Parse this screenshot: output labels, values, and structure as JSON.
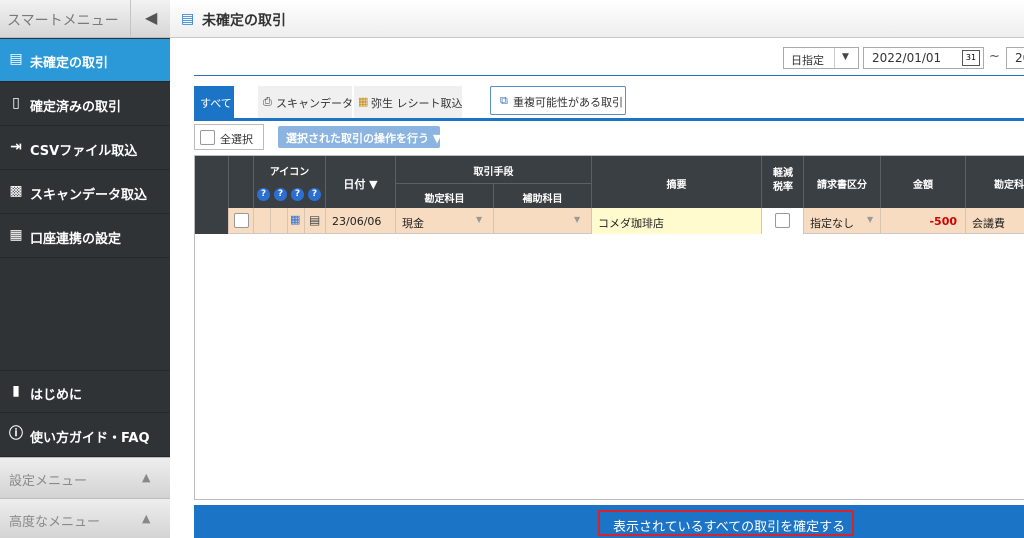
{
  "sidebar": {
    "title": "スマートメニュー",
    "collapse_icon": "chevron-left-icon",
    "items": [
      {
        "label": "未確定の取引",
        "icon": "book-icon",
        "active": true
      },
      {
        "label": "確定済みの取引",
        "icon": "document-icon",
        "active": false
      },
      {
        "label": "CSVファイル取込",
        "icon": "file-import-icon",
        "active": false
      },
      {
        "label": "スキャンデータ取込",
        "icon": "scanner-icon",
        "active": false
      },
      {
        "label": "口座連携の設定",
        "icon": "bank-icon",
        "active": false
      },
      {
        "label": "はじめに",
        "icon": "notebook-icon",
        "active": false
      },
      {
        "label": "使い方ガイド・FAQ",
        "icon": "help-circle-icon",
        "active": false
      }
    ],
    "bottom": [
      {
        "label": "設定メニュー"
      },
      {
        "label": "高度なメニュー"
      }
    ]
  },
  "header": {
    "title": "未確定の取引"
  },
  "filter": {
    "period_type": "日指定",
    "date_from": "2022/01/01",
    "tilde": "~",
    "date_to_partial": "20",
    "calendar_digit": "31"
  },
  "tabs": [
    {
      "label": "すべて",
      "active": true
    },
    {
      "label": "スキャンデータ"
    },
    {
      "label": "弥生 レシート取込"
    }
  ],
  "dup_button": "重複可能性がある取引",
  "toolbar": {
    "select_all": "全選択",
    "operate": "選択された取引の操作を行う ▼"
  },
  "table": {
    "headers": {
      "icon": "アイコン",
      "date": "日付 ▼",
      "method": "取引手段",
      "account": "勘定科目",
      "sub_account": "補助科目",
      "summary": "摘要",
      "reduced_tax": "軽減税率",
      "invoice": "請求書区分",
      "amount": "金額",
      "account2": "勘定科"
    },
    "help_marks": [
      "?",
      "?",
      "?",
      "?"
    ],
    "rows": [
      {
        "date": "23/06/06",
        "method_account": "現金",
        "sub_account": "",
        "summary": "コメダ珈琲店",
        "reduced_tax": false,
        "invoice": "指定なし",
        "amount": "-500",
        "account": "会議費"
      }
    ]
  },
  "confirm": {
    "label": "表示されているすべての取引を確定する"
  },
  "colors": {
    "sidebar": "#2f3336",
    "active": "#2b99d7",
    "primary": "#1c74c6",
    "row": "#f7dcc1",
    "highlight_border": "#d9232c",
    "amount": "#d40000"
  }
}
